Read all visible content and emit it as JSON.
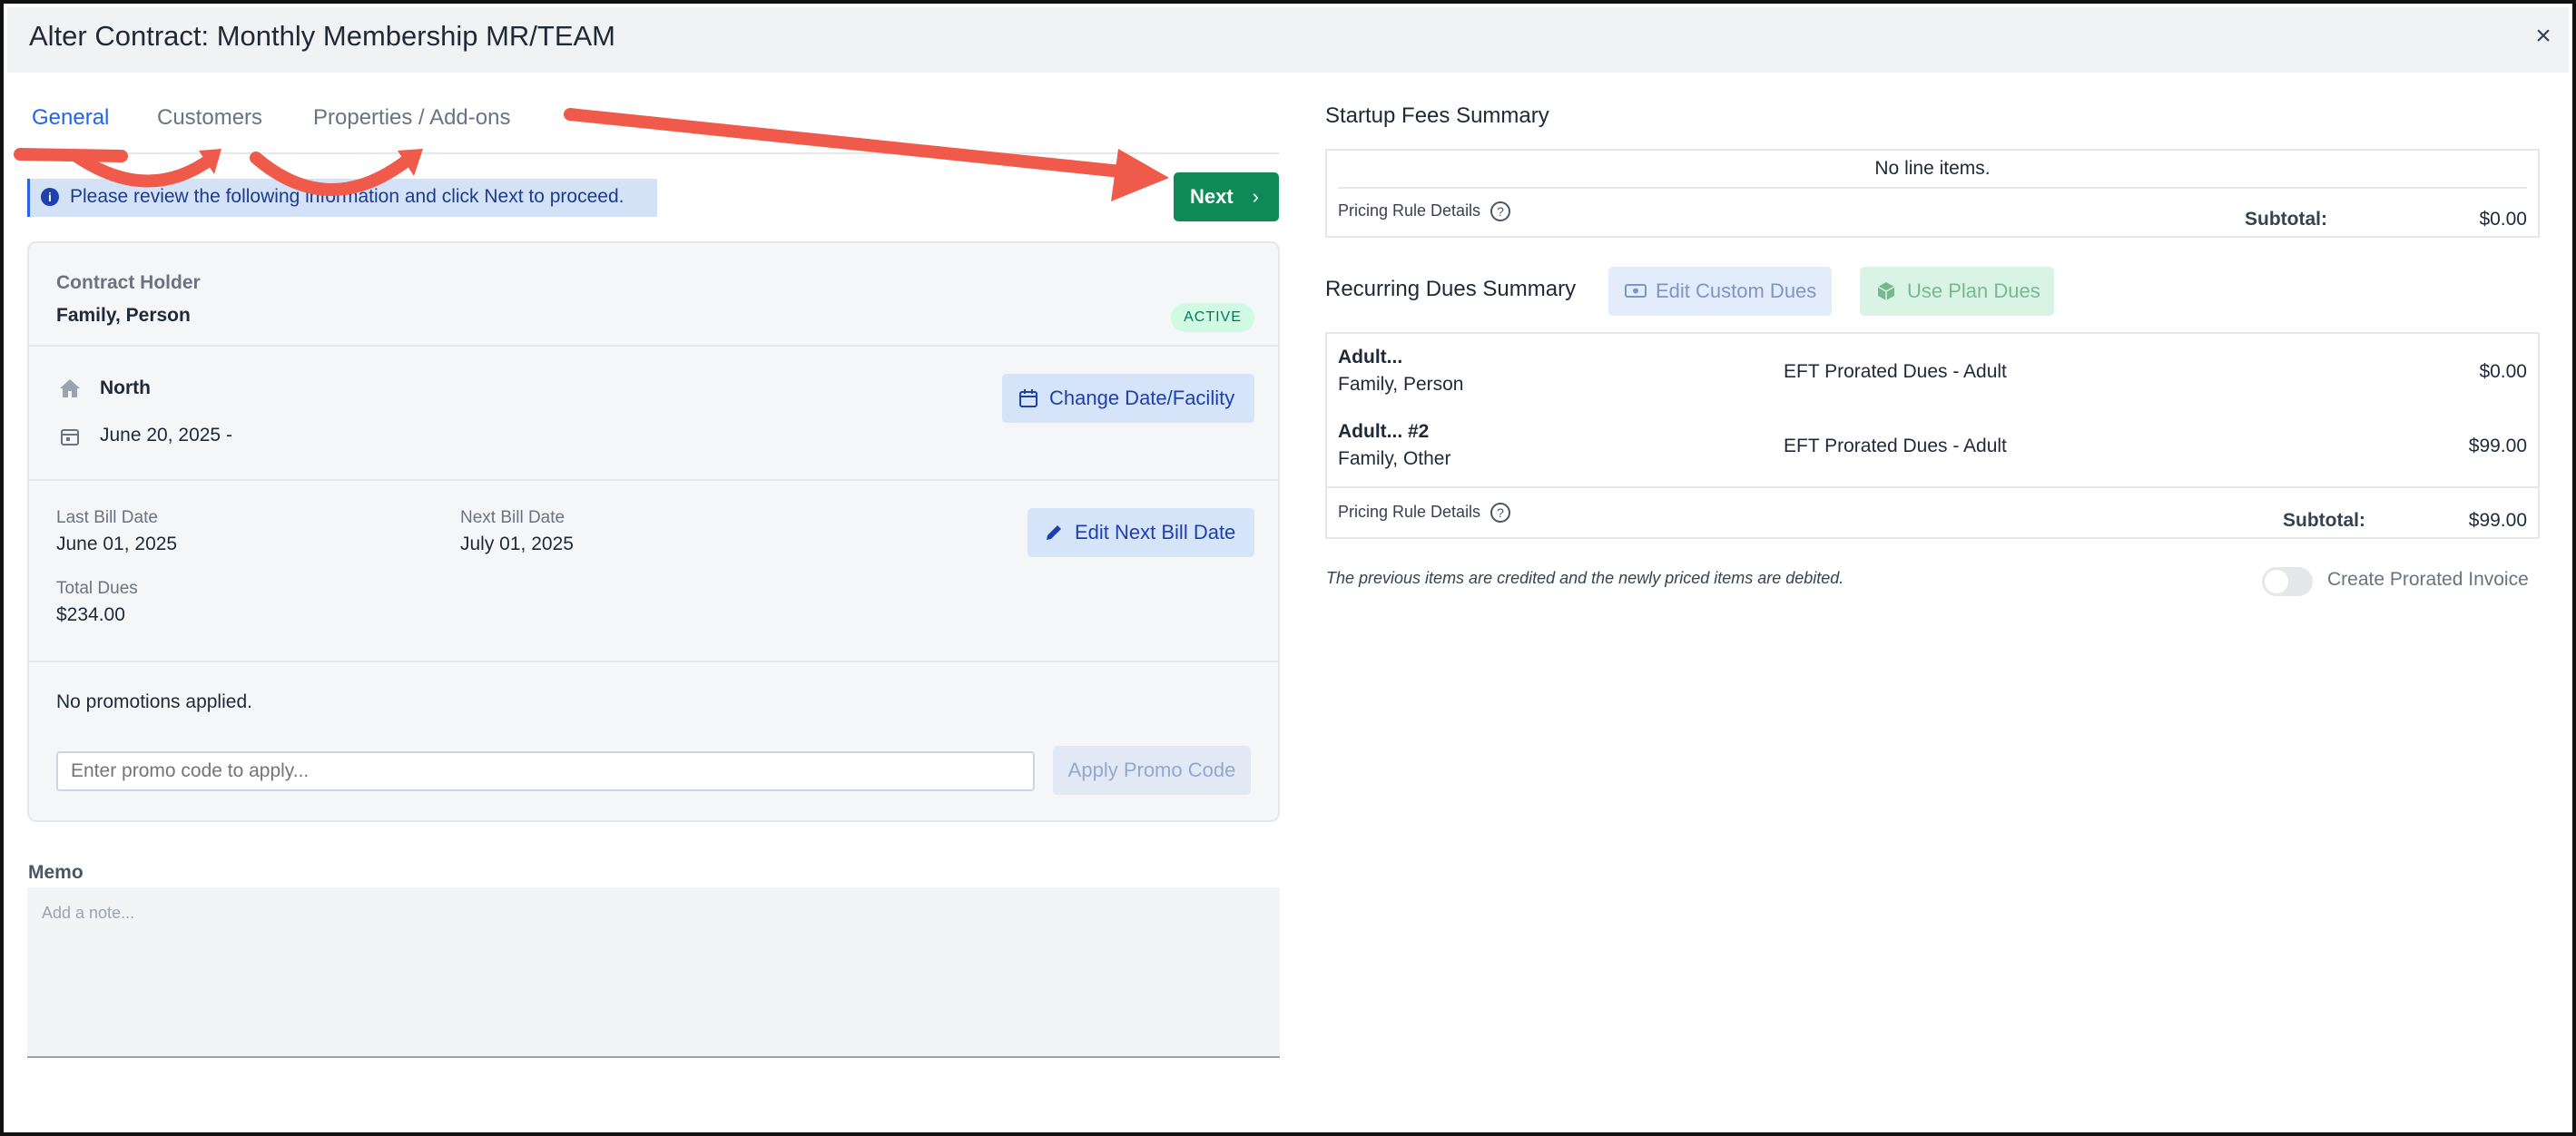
{
  "window": {
    "title": "Alter Contract: Monthly Membership MR/TEAM",
    "close_glyph": "×"
  },
  "tabs": [
    {
      "label": "General",
      "active": true
    },
    {
      "label": "Customers",
      "active": false
    },
    {
      "label": "Properties / Add-ons",
      "active": false
    }
  ],
  "info": {
    "message": "Please review the following information and click Next to proceed.",
    "icon": "info-circle-icon"
  },
  "next_button": {
    "label": "Next",
    "icon": "chevron-right-icon",
    "glyph": "›"
  },
  "contract": {
    "holder_label": "Contract Holder",
    "holder_name": "Family, Person",
    "status": "ACTIVE",
    "facility": "North",
    "date": "June 20, 2025 -",
    "change_button": "Change Date/Facility",
    "last_bill_label": "Last Bill Date",
    "last_bill_value": "June 01, 2025",
    "next_bill_label": "Next Bill Date",
    "next_bill_value": "July 01, 2025",
    "edit_next_bill_button": "Edit Next Bill Date",
    "total_dues_label": "Total Dues",
    "total_dues_value": "$234.00",
    "promotions_text": "No promotions applied.",
    "promo_placeholder": "Enter promo code to apply...",
    "apply_promo_button": "Apply Promo Code"
  },
  "memo": {
    "label": "Memo",
    "placeholder": "Add a note..."
  },
  "startup_fees": {
    "title": "Startup Fees Summary",
    "empty_text": "No line items.",
    "pricing_rule_label": "Pricing Rule Details",
    "subtotal_label": "Subtotal:",
    "subtotal_value": "$0.00"
  },
  "recurring_dues": {
    "title": "Recurring Dues Summary",
    "edit_custom_button": "Edit Custom Dues",
    "use_plan_button": "Use Plan Dues",
    "rows": [
      {
        "name": "Adult...",
        "customer": "Family, Person",
        "description": "EFT Prorated Dues - Adult",
        "amount": "$0.00"
      },
      {
        "name": "Adult... #2",
        "customer": "Family, Other",
        "description": "EFT Prorated Dues - Adult",
        "amount": "$99.00"
      }
    ],
    "pricing_rule_label": "Pricing Rule Details",
    "subtotal_label": "Subtotal:",
    "subtotal_value": "$99.00",
    "note": "The previous items are credited and the newly priced items are debited.",
    "toggle_label": "Create Prorated Invoice",
    "toggle_on": false
  },
  "help_glyph": "?",
  "colors": {
    "accent": "#2563eb",
    "next_button": "#0f8a57",
    "annotation_arrow": "#f05a4a",
    "active_badge_bg": "#d1fae5"
  }
}
